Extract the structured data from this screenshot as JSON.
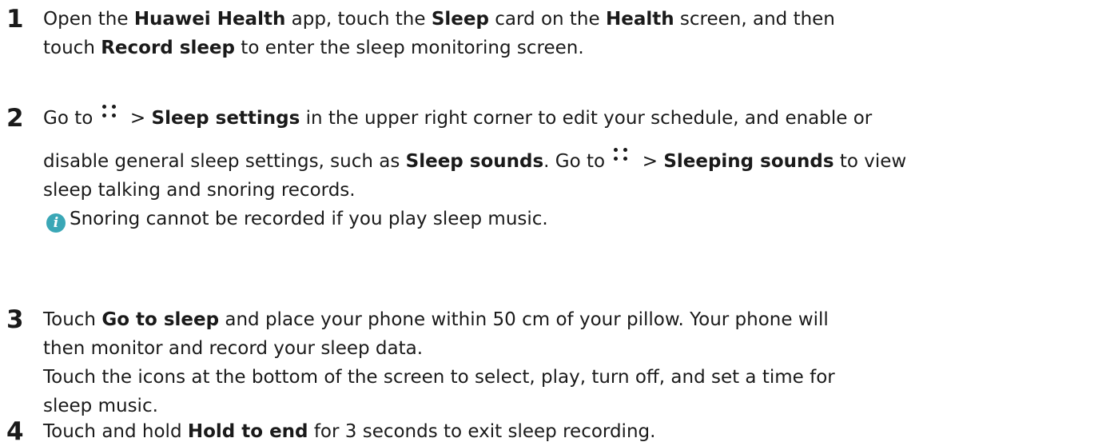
{
  "steps": [
    {
      "number": "1",
      "t1": "Open the ",
      "b1": "Huawei Health",
      "t2": " app, touch the ",
      "b2": "Sleep",
      "t3": " card on the ",
      "b3": "Health",
      "t4": " screen, and then",
      "t5": "touch ",
      "b4": "Record sleep",
      "t6": " to enter the sleep monitoring screen."
    },
    {
      "number": "2",
      "t1": "Go to ",
      "t2": " > ",
      "b1": "Sleep settings",
      "t3": " in the upper right corner to edit your schedule, and enable or",
      "t4": "disable general sleep settings, such as ",
      "b2": "Sleep sounds",
      "t5": ". Go to ",
      "t6": " > ",
      "b3": "Sleeping sounds",
      "t7": " to view",
      "t8": "sleep talking and snoring records.",
      "note_icon": "i",
      "note": "Snoring cannot be recorded if you play sleep music."
    },
    {
      "number": "3",
      "t1": "Touch ",
      "b1": "Go to sleep",
      "t2": " and place your phone within 50 cm of your pillow. Your phone will",
      "t3": "then monitor and record your sleep data.",
      "t4": "Touch the icons at the bottom of the screen to select, play, turn off, and set a time for",
      "t5": "sleep music."
    },
    {
      "number": "4",
      "t1": "Touch and hold ",
      "b1": "Hold to end",
      "t2": " for 3 seconds to exit sleep recording."
    }
  ],
  "icons": {
    "more": "more-dots-icon",
    "info": "info-icon"
  },
  "colors": {
    "text": "#1a1a1a",
    "info_icon": "#3aa7b6"
  }
}
